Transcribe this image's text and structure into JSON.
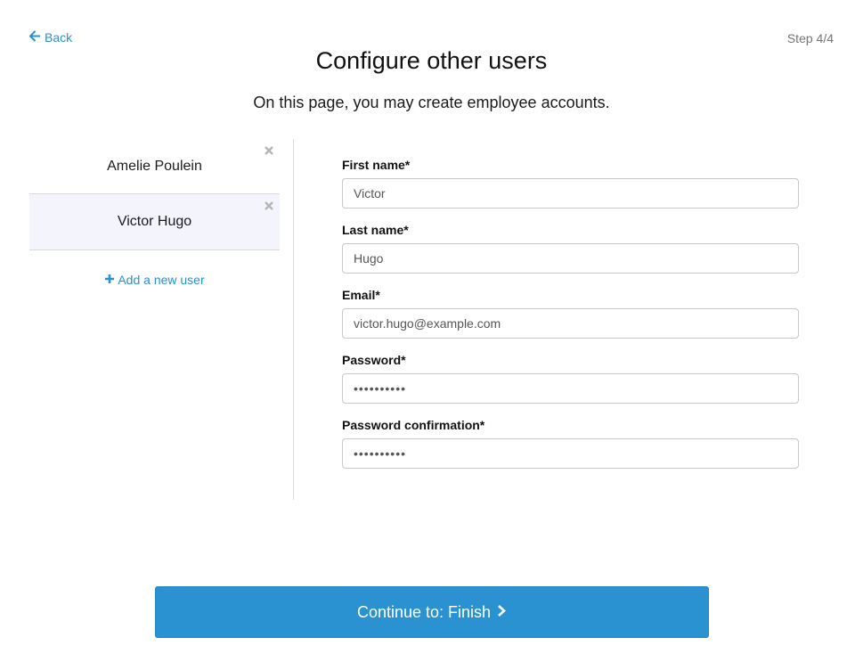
{
  "header": {
    "back_label": "Back",
    "step_label": "Step 4/4",
    "title": "Configure other users",
    "subtitle": "On this page, you may create employee accounts."
  },
  "users": [
    {
      "name": "Amelie Poulein",
      "active": false
    },
    {
      "name": "Victor Hugo",
      "active": true
    }
  ],
  "add_user_label": "Add a new user",
  "form": {
    "first_name": {
      "label": "First name*",
      "value": "Victor"
    },
    "last_name": {
      "label": "Last name*",
      "value": "Hugo"
    },
    "email": {
      "label": "Email*",
      "value": "victor.hugo@example.com"
    },
    "password": {
      "label": "Password*",
      "value": "password12"
    },
    "password_confirmation": {
      "label": "Password confirmation*",
      "value": "password12"
    }
  },
  "continue_label": "Continue to: Finish",
  "colors": {
    "accent": "#2b8fd0",
    "button": "#2b92d1",
    "active_row": "#f4f4fc",
    "remove_icon": "#b5b5b5"
  },
  "icons": {
    "back": "arrow-left-icon",
    "remove": "close-icon",
    "add": "plus-icon",
    "continue": "chevron-right-icon"
  }
}
